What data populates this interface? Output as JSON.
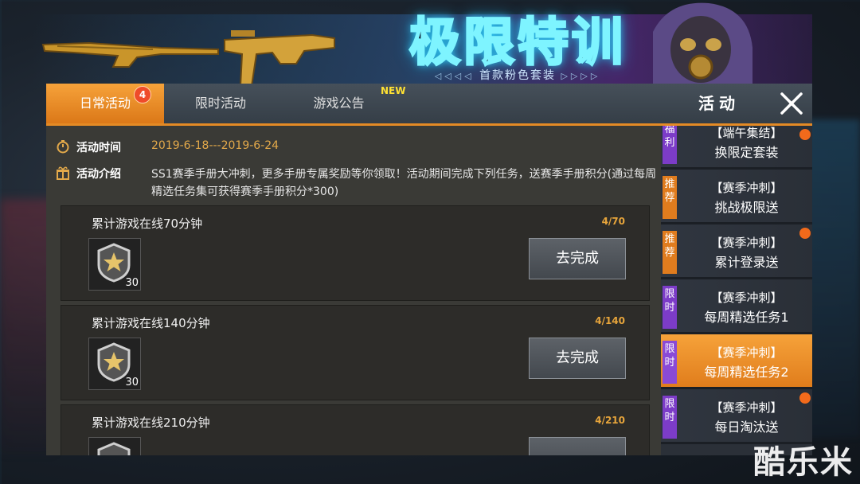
{
  "banner": {
    "title": "极限特训",
    "subtitle": "首款粉色套装",
    "arrows_left": "◁◁◁◁",
    "arrows_right": "▷▷▷▷"
  },
  "tabs": [
    {
      "label": "日常活动",
      "badge": "4",
      "active": true
    },
    {
      "label": "限时活动",
      "active": false
    },
    {
      "label": "游戏公告",
      "badge": "NEW",
      "active": false
    }
  ],
  "panel": {
    "title": "活动",
    "close_icon": "close-x-icon"
  },
  "info": {
    "time_label": "活动时间",
    "time_value": "2019-6-18---2019-6-24",
    "intro_label": "活动介绍",
    "intro_text": "SS1赛季手册大冲刺，更多手册专属奖励等你领取！活动期间完成下列任务，送赛季手册积分(通过每周精选任务集可获得赛季手册积分*300)"
  },
  "tasks": [
    {
      "title": "累计游戏在线70分钟",
      "progress": "4/70",
      "reward_qty": "30",
      "button": "去完成"
    },
    {
      "title": "累计游戏在线140分钟",
      "progress": "4/140",
      "reward_qty": "30",
      "button": "去完成"
    },
    {
      "title": "累计游戏在线210分钟",
      "progress": "4/210",
      "reward_qty": "",
      "button": ""
    }
  ],
  "side_list": [
    {
      "tag": "福利",
      "line1": "【端午集结】",
      "line2": "换限定套装",
      "dot": true,
      "active": false
    },
    {
      "tag": "推荐",
      "line1": "【赛季冲刺】",
      "line2": "挑战极限送",
      "dot": false,
      "active": false
    },
    {
      "tag": "推荐",
      "line1": "【赛季冲刺】",
      "line2": "累计登录送",
      "dot": true,
      "active": false
    },
    {
      "tag": "限时",
      "line1": "【赛季冲刺】",
      "line2": "每周精选任务1",
      "dot": false,
      "active": false
    },
    {
      "tag": "限时",
      "line1": "【赛季冲刺】",
      "line2": "每周精选任务2",
      "dot": false,
      "active": true
    },
    {
      "tag": "限时",
      "line1": "【赛季冲刺】",
      "line2": "每日淘汰送",
      "dot": true,
      "active": false
    }
  ],
  "watermark": "酷乐米",
  "colors": {
    "accent": "#e48a25",
    "highlight_text": "#e3a94a",
    "tag_purple": "#7c3cc8",
    "tag_orange": "#e07c1e"
  }
}
